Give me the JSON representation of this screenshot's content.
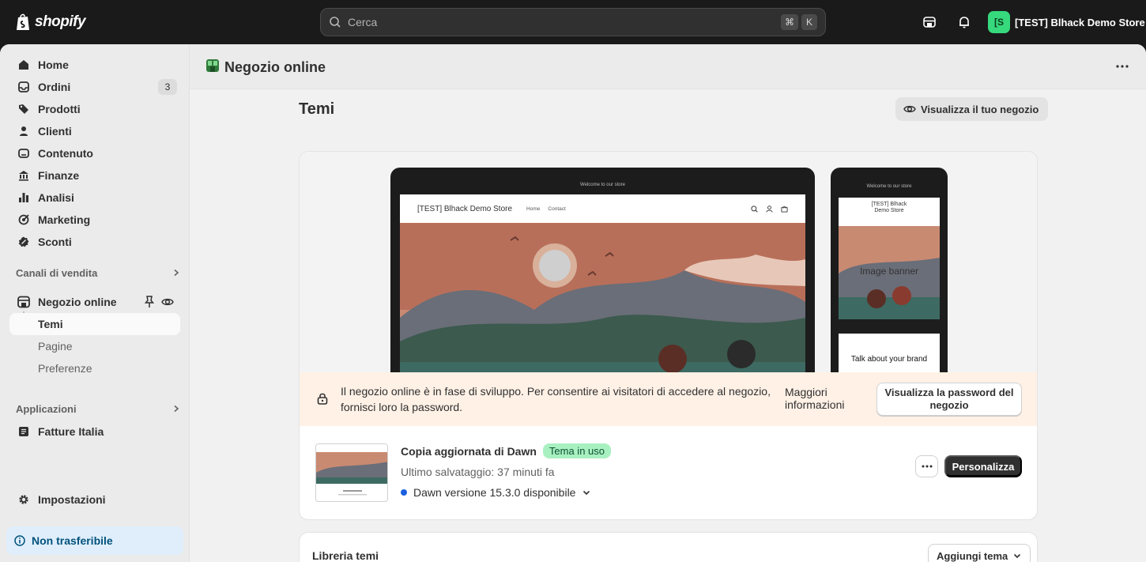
{
  "topbar": {
    "logo_text": "shopify",
    "search_placeholder": "Cerca",
    "shortcut_keys": [
      "⌘",
      "K"
    ],
    "store_initial": "[S",
    "store_name": "[TEST] Blhack Demo Store"
  },
  "sidebar": {
    "items": [
      {
        "label": "Home",
        "icon": "home-icon"
      },
      {
        "label": "Ordini",
        "icon": "inbox-icon",
        "badge": "3"
      },
      {
        "label": "Prodotti",
        "icon": "tag-icon"
      },
      {
        "label": "Clienti",
        "icon": "person-icon"
      },
      {
        "label": "Contenuto",
        "icon": "content-icon"
      },
      {
        "label": "Finanze",
        "icon": "bank-icon"
      },
      {
        "label": "Analisi",
        "icon": "bar-chart-icon"
      },
      {
        "label": "Marketing",
        "icon": "target-icon"
      },
      {
        "label": "Sconti",
        "icon": "discount-icon"
      }
    ],
    "sales_channels_heading": "Canali di vendita",
    "online_store": "Negozio online",
    "sub_items": [
      "Temi",
      "Pagine",
      "Preferenze"
    ],
    "apps_heading": "Applicazioni",
    "apps": [
      "Fatture Italia"
    ],
    "settings": "Impostazioni",
    "non_transferable": "Non trasferibile"
  },
  "page": {
    "header_title": "Negozio online",
    "title": "Temi",
    "view_store_button": "Visualizza il tuo negozio"
  },
  "preview": {
    "announcement": "Welcome to our store",
    "store_name": "[TEST] Blhack Demo Store",
    "nav": [
      "Home",
      "Contact"
    ],
    "mobile_store_name": "[TEST] Blhack Demo Store",
    "mobile_banner": "Image banner",
    "mobile_text": "Talk about your brand"
  },
  "dev_banner": {
    "message": "Il negozio online è in fase di sviluppo. Per consentire ai visitatori di accedere al negozio, fornisci loro la password.",
    "more_info": "Maggiori informazioni",
    "password_button": "Visualizza la password del negozio"
  },
  "current_theme": {
    "name": "Copia aggiornata di Dawn",
    "status_badge": "Tema in uso",
    "last_saved": "Ultimo salvataggio: 37 minuti fa",
    "version": "Dawn versione 15.3.0 disponibile",
    "customize_button": "Personalizza"
  },
  "library": {
    "title": "Libreria temi",
    "add_button": "Aggiungi tema"
  },
  "colors": {
    "topbar": "#1a1a1a",
    "accent_green": "#36d97c",
    "badge_green": "#a9f0c1",
    "banner_bg": "#fff1e6",
    "info_bg": "#e0eefc",
    "primary_button": "#303030"
  }
}
